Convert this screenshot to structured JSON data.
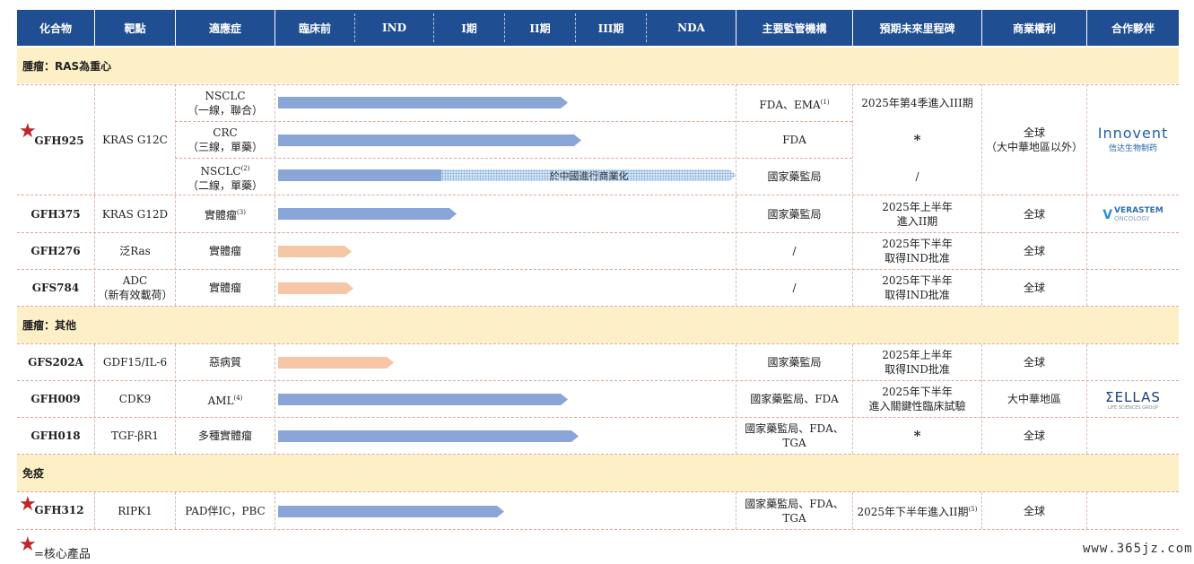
{
  "header": [
    "化合物",
    "靶點",
    "適應症",
    "臨床前",
    "IND",
    "I期",
    "II期",
    "III期",
    "NDA",
    "主要監管機構",
    "預期未來里程碑",
    "商業權利",
    "合作夥伴"
  ],
  "sections": {
    "s1": "腫瘤：RAS為重心",
    "s2": "腫瘤：其他",
    "s3": "免疫"
  },
  "gfh925": {
    "compound": "GFH925",
    "target": "KRAS G12C",
    "rights": "全球",
    "rights2": "（大中華地區以外）",
    "partner": "Innovent",
    "partner_sub": "信达生物制药",
    "rows": [
      {
        "ind1": "NSCLC",
        "ind2": "（一線，聯合）",
        "sup": "",
        "reg": "FDA、EMA",
        "reg_sup": "(1)",
        "mile": "2025年第4季進入III期",
        "progress": "II期"
      },
      {
        "ind1": "CRC",
        "ind2": "（三線，單藥）",
        "sup": "",
        "reg": "FDA",
        "reg_sup": "",
        "mile": "*",
        "progress": "II期"
      },
      {
        "ind1": "NSCLC",
        "ind2": "（二線，單藥）",
        "sup": "(2)",
        "reg": "國家藥監局",
        "reg_sup": "",
        "mile": "/",
        "progress": "I期",
        "commercial": "於中國進行商業化"
      }
    ]
  },
  "gfh375": {
    "compound": "GFH375",
    "target": "KRAS G12D",
    "ind": "實體瘤",
    "ind_sup": "(3)",
    "reg": "國家藥監局",
    "mile1": "2025年上半年",
    "mile2": "進入II期",
    "rights": "全球",
    "partner": "VERASTEM",
    "partner_sub": "ONCOLOGY",
    "progress": "I期"
  },
  "gfh276": {
    "compound": "GFH276",
    "target": "泛Ras",
    "ind": "實體瘤",
    "reg": "/",
    "mile1": "2025年下半年",
    "mile2": "取得IND批准",
    "rights": "全球",
    "progress": "臨床前"
  },
  "gfs784": {
    "compound": "GFS784",
    "target1": "ADC",
    "target2": "（新有效載荷）",
    "ind": "實體瘤",
    "reg": "/",
    "mile1": "2025年下半年",
    "mile2": "取得IND批准",
    "rights": "全球",
    "progress": "臨床前"
  },
  "gfs202a": {
    "compound": "GFS202A",
    "target": "GDF15/IL-6",
    "ind": "惡病質",
    "reg": "國家藥監局",
    "mile1": "2025年上半年",
    "mile2": "取得IND批准",
    "rights": "全球",
    "progress": "臨床前"
  },
  "gfh009": {
    "compound": "GFH009",
    "target": "CDK9",
    "ind": "AML",
    "ind_sup": "(4)",
    "reg": "國家藥監局、FDA",
    "mile1": "2025年下半年",
    "mile2": "進入關鍵性臨床試驗",
    "rights": "大中華地區",
    "partner": "ΣELLAS",
    "partner_sub": "LIFE SCIENCES GROUP",
    "progress": "II期"
  },
  "gfh018": {
    "compound": "GFH018",
    "target": "TGF-βR1",
    "ind": "多種實體瘤",
    "reg1": "國家藥監局、FDA、",
    "reg2": "TGA",
    "mile": "*",
    "rights": "全球",
    "progress": "II期"
  },
  "gfh312": {
    "compound": "GFH312",
    "target": "RIPK1",
    "ind": "PAD伴IC，PBC",
    "reg1": "國家藥監局、FDA、",
    "reg2": "TGA",
    "mile": "2025年下半年進入II期",
    "mile_sup": "(5)",
    "rights": "全球",
    "progress": "I期"
  },
  "legend": "=核心產品",
  "watermark": "www.365jz.com",
  "colors": {
    "header_bg": "#1f4e92",
    "section_bg": "#fdf0c6",
    "bar_blue": "#8aa5d8",
    "bar_orange": "#f6c6a6",
    "star": "#c0262a"
  }
}
